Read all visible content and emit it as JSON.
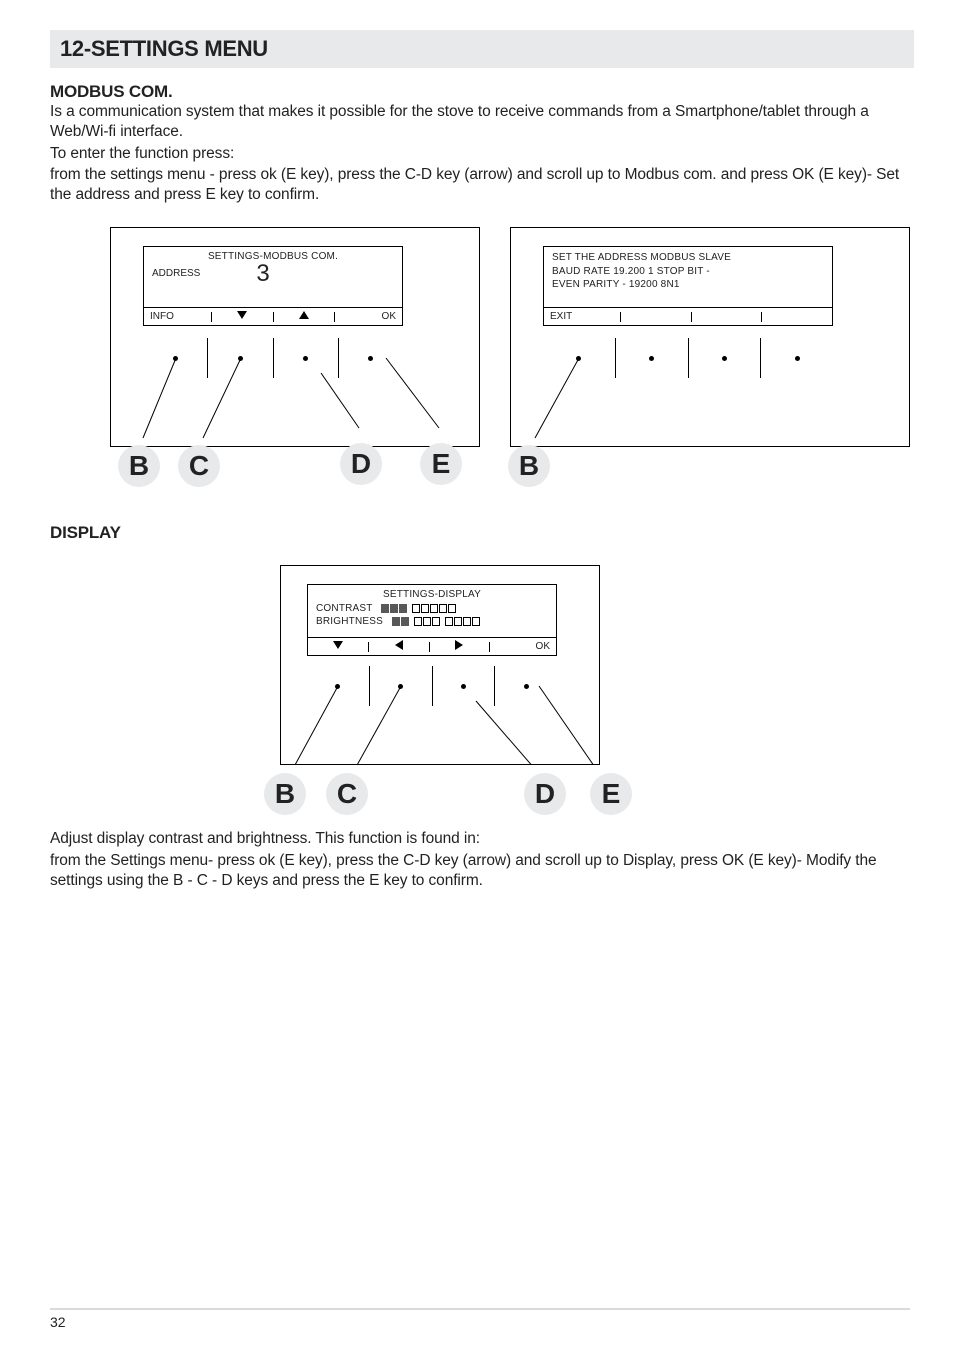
{
  "header": {
    "title": "12-SETTINGS MENU"
  },
  "modbus": {
    "heading": "MODBUS COM.",
    "para1": "Is a communication system that makes it possible for the stove to receive commands from a Smartphone/tablet through a Web/Wi-fi interface.",
    "para2": "To enter the function press:",
    "para3": "from the settings menu - press ok (E key), press the C-D key (arrow) and scroll up to Modbus com. and press OK (E key)- Set the address and press E key to confirm.",
    "screen_left": {
      "title": "SETTINGS-MODBUS COM.",
      "label": "ADDRESS",
      "value": "3",
      "footer_left": "INFO",
      "footer_right": "OK"
    },
    "screen_right": {
      "l1": "SET THE ADDRESS  MODBUS SLAVE",
      "l2": "BAUD RATE 19.200  1 STOP BIT  -",
      "l3": "EVEN PARITY   -   19200 8N1",
      "footer_left": "EXIT"
    }
  },
  "display": {
    "heading": "DISPLAY",
    "screen": {
      "title": "SETTINGS-DISPLAY",
      "row1": "CONTRAST",
      "row2": "BRIGHTNESS",
      "footer_right": "OK"
    },
    "para": "Adjust display contrast and brightness. This function is found in:",
    "para2": "from the Settings menu- press ok (E key), press the C-D key (arrow) and scroll up to Display, press OK (E key)- Modify the settings using the B - C - D keys and press the E key to confirm."
  },
  "bubbles": {
    "B": "B",
    "C": "C",
    "D": "D",
    "E": "E"
  },
  "page": "32"
}
